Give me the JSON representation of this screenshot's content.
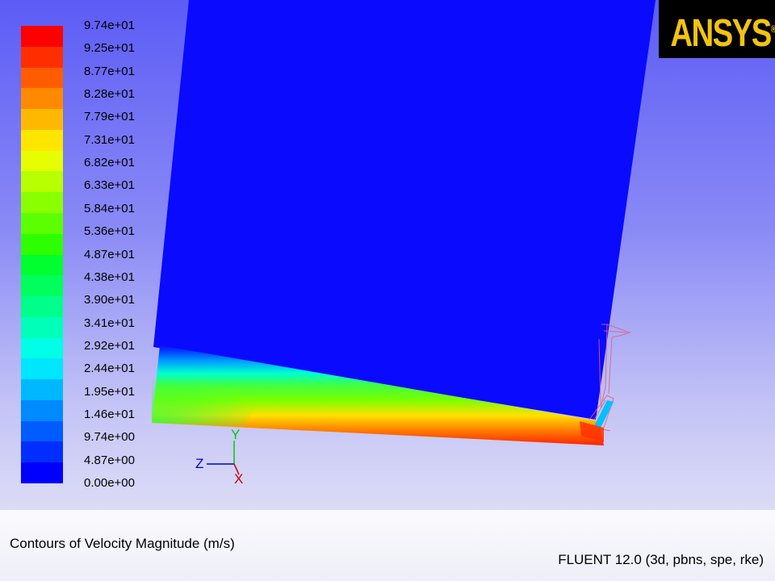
{
  "colorbar": {
    "labels": [
      "9.74e+01",
      "9.25e+01",
      "8.77e+01",
      "8.28e+01",
      "7.79e+01",
      "7.31e+01",
      "6.82e+01",
      "6.33e+01",
      "5.84e+01",
      "5.36e+01",
      "4.87e+01",
      "4.38e+01",
      "3.90e+01",
      "3.41e+01",
      "2.92e+01",
      "2.44e+01",
      "1.95e+01",
      "1.46e+01",
      "9.74e+00",
      "4.87e+00",
      "0.00e+00"
    ],
    "colors": [
      "#ff0000",
      "#ff2e00",
      "#ff5c00",
      "#ff8a00",
      "#ffb800",
      "#ffe600",
      "#e6ff00",
      "#b8ff00",
      "#8aff00",
      "#5cff00",
      "#2eff00",
      "#00ff2e",
      "#00ff5c",
      "#00ff8a",
      "#00ffb8",
      "#00ffe6",
      "#00e6ff",
      "#00b8ff",
      "#008aff",
      "#005cff",
      "#002eff",
      "#0000ff"
    ]
  },
  "logo": {
    "text": "ANSYS",
    "reg_mark": "®",
    "color": "#f1c40f"
  },
  "axes": {
    "y": "Y",
    "z": "Z",
    "x": "X"
  },
  "footer": {
    "title": "Contours of Velocity Magnitude (m/s)",
    "version": "FLUENT 12.0 (3d, pbns, spe, rke)"
  }
}
